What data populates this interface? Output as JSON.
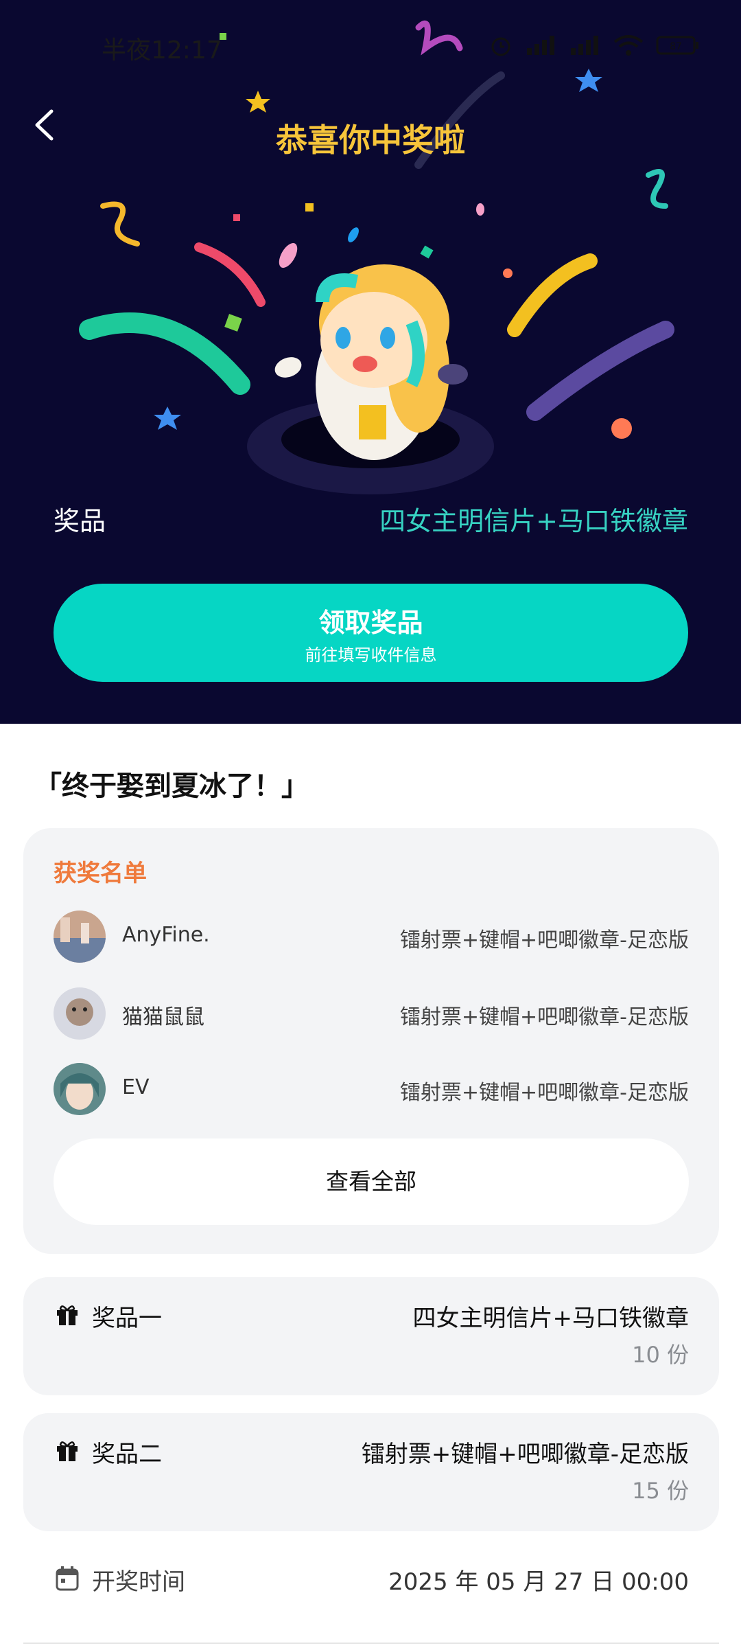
{
  "status_bar": {
    "time": "半夜12:17",
    "battery": "87"
  },
  "header": {
    "title": "恭喜你中奖啦",
    "back_icon": "chevron-left-icon"
  },
  "prize": {
    "label": "奖品",
    "value": "四女主明信片+马口铁徽章"
  },
  "claim_button": {
    "label": "领取奖品",
    "sublabel": "前往填写收件信息"
  },
  "quote": "「终于娶到夏冰了！」",
  "winners": {
    "title": "获奖名单",
    "rows": [
      {
        "name": "AnyFine.",
        "prize": "镭射票+键帽+吧唧徽章-足恋版"
      },
      {
        "name": "猫猫鼠鼠",
        "prize": "镭射票+键帽+吧唧徽章-足恋版"
      },
      {
        "name": "EV",
        "prize": "镭射票+键帽+吧唧徽章-足恋版"
      }
    ],
    "view_all": "查看全部"
  },
  "prize_list": [
    {
      "label": "奖品一",
      "value": "四女主明信片+马口铁徽章",
      "count": "10 份"
    },
    {
      "label": "奖品二",
      "value": "镭射票+键帽+吧唧徽章-足恋版",
      "count": "15 份"
    }
  ],
  "draw_time": {
    "label": "开奖时间",
    "value": "2025 年 05 月 27 日 00:00"
  },
  "colors": {
    "hero_bg": "#0a0830",
    "title_yellow": "#f7c53a",
    "accent_teal": "#06d6c4",
    "prize_teal": "#37d3c3",
    "winners_orange": "#ef7a3c",
    "card_bg": "#f3f4f6"
  }
}
